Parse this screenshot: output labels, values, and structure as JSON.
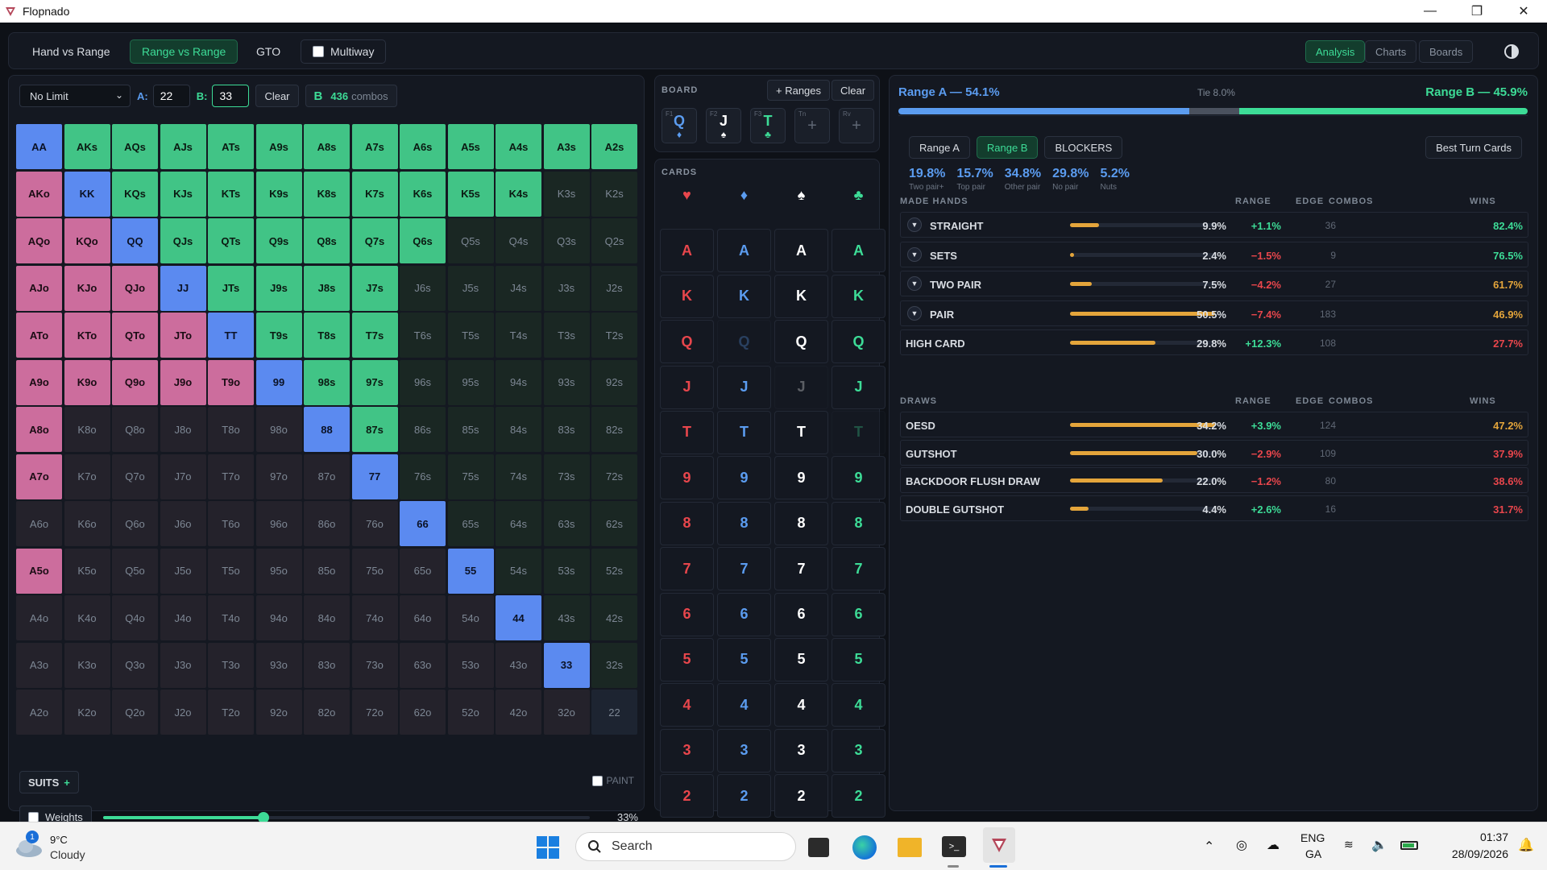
{
  "window": {
    "title": "Flopnado",
    "minimize": "—",
    "maximize": "❐",
    "close": "✕"
  },
  "topbar": {
    "modes": [
      "Hand vs Range",
      "Range vs Range",
      "GTO"
    ],
    "multiway_label": "Multiway",
    "right_tabs": [
      "Analysis",
      "Charts",
      "Boards"
    ]
  },
  "controls": {
    "game": "No Limit",
    "a_label": "A:",
    "a_value": "22",
    "b_label": "B:",
    "b_value": "33",
    "clear": "Clear",
    "b_badge": "B",
    "combos_count": "436",
    "combos_label": "combos"
  },
  "range_grid": {
    "rows": [
      [
        "AA",
        "AKs",
        "AQs",
        "AJs",
        "ATs",
        "A9s",
        "A8s",
        "A7s",
        "A6s",
        "A5s",
        "A4s",
        "A3s",
        "A2s"
      ],
      [
        "AKo",
        "KK",
        "KQs",
        "KJs",
        "KTs",
        "K9s",
        "K8s",
        "K7s",
        "K6s",
        "K5s",
        "K4s",
        "K3s",
        "K2s"
      ],
      [
        "AQo",
        "KQo",
        "QQ",
        "QJs",
        "QTs",
        "Q9s",
        "Q8s",
        "Q7s",
        "Q6s",
        "Q5s",
        "Q4s",
        "Q3s",
        "Q2s"
      ],
      [
        "AJo",
        "KJo",
        "QJo",
        "JJ",
        "JTs",
        "J9s",
        "J8s",
        "J7s",
        "J6s",
        "J5s",
        "J4s",
        "J3s",
        "J2s"
      ],
      [
        "ATo",
        "KTo",
        "QTo",
        "JTo",
        "TT",
        "T9s",
        "T8s",
        "T7s",
        "T6s",
        "T5s",
        "T4s",
        "T3s",
        "T2s"
      ],
      [
        "A9o",
        "K9o",
        "Q9o",
        "J9o",
        "T9o",
        "99",
        "98s",
        "97s",
        "96s",
        "95s",
        "94s",
        "93s",
        "92s"
      ],
      [
        "A8o",
        "K8o",
        "Q8o",
        "J8o",
        "T8o",
        "98o",
        "88",
        "87s",
        "86s",
        "85s",
        "84s",
        "83s",
        "82s"
      ],
      [
        "A7o",
        "K7o",
        "Q7o",
        "J7o",
        "T7o",
        "97o",
        "87o",
        "77",
        "76s",
        "75s",
        "74s",
        "73s",
        "72s"
      ],
      [
        "A6o",
        "K6o",
        "Q6o",
        "J6o",
        "T6o",
        "96o",
        "86o",
        "76o",
        "66",
        "65s",
        "64s",
        "63s",
        "62s"
      ],
      [
        "A5o",
        "K5o",
        "Q5o",
        "J5o",
        "T5o",
        "95o",
        "85o",
        "75o",
        "65o",
        "55",
        "54s",
        "53s",
        "52s"
      ],
      [
        "A4o",
        "K4o",
        "Q4o",
        "J4o",
        "T4o",
        "94o",
        "84o",
        "74o",
        "64o",
        "54o",
        "44",
        "43s",
        "42s"
      ],
      [
        "A3o",
        "K3o",
        "Q3o",
        "J3o",
        "T3o",
        "93o",
        "83o",
        "73o",
        "63o",
        "53o",
        "43o",
        "33",
        "32s"
      ],
      [
        "A2o",
        "K2o",
        "Q2o",
        "J2o",
        "T2o",
        "92o",
        "82o",
        "72o",
        "62o",
        "52o",
        "42o",
        "32o",
        "22"
      ]
    ],
    "states": [
      "PBBBBBBBBBBBB",
      "APBBBBBBBBB..",
      "AAPBBBBBB....",
      "AAAPBBBB.....",
      "AAAAPBBB.....",
      "AAAAAPBB.....",
      "A.....PB.....",
      "A......P.....",
      "........P....",
      "A........P...",
      "..........P..",
      "...........P.",
      "............."
    ]
  },
  "suits_button": "SUITS",
  "suits_plus": "+",
  "paint_label": "PAINT",
  "weights": {
    "label": "Weights",
    "value_text": "33%",
    "value": 0.33
  },
  "board": {
    "label": "BOARD",
    "add_ranges": "+ Ranges",
    "clear": "Clear",
    "cards": [
      {
        "slot": "F1",
        "rank": "Q",
        "suit": "♦",
        "color": "#5b9cf0"
      },
      {
        "slot": "F2",
        "rank": "J",
        "suit": "♠",
        "color": "#ffffff"
      },
      {
        "slot": "F3",
        "rank": "T",
        "suit": "♣",
        "color": "#3ddc97"
      },
      {
        "slot": "Tn",
        "rank": "+",
        "suit": "",
        "color": "#5f6774"
      },
      {
        "slot": "Rv",
        "rank": "+",
        "suit": "",
        "color": "#5f6774"
      }
    ]
  },
  "cards_panel": {
    "label": "CARDS",
    "suits": [
      {
        "symbol": "♥",
        "color": "#e8464c"
      },
      {
        "symbol": "♦",
        "color": "#5b9cf0"
      },
      {
        "symbol": "♠",
        "color": "#ffffff"
      },
      {
        "symbol": "♣",
        "color": "#3ddc97"
      }
    ],
    "ranks": [
      "A",
      "K",
      "Q",
      "J",
      "T",
      "9",
      "8",
      "7",
      "6",
      "5",
      "4",
      "3",
      "2"
    ],
    "used": [
      "Q-1",
      "J-2",
      "T-3"
    ]
  },
  "equity": {
    "a_label": "Range A — 54.1%",
    "tie_label": "Tie 8.0%",
    "b_label": "Range B — 45.9%",
    "a": 0.462,
    "tie": 0.08,
    "b": 0.458
  },
  "analysis_tabs": [
    "Range A",
    "Range B",
    "BLOCKERS"
  ],
  "best_turn": "Best Turn Cards",
  "kpis": [
    {
      "value": "19.8%",
      "label": "Two pair+"
    },
    {
      "value": "15.7%",
      "label": "Top pair"
    },
    {
      "value": "34.8%",
      "label": "Other pair"
    },
    {
      "value": "29.8%",
      "label": "No pair"
    },
    {
      "value": "5.2%",
      "label": "Nuts"
    }
  ],
  "made_hands": {
    "header": "MADE HANDS",
    "cols": [
      "RANGE",
      "EDGE",
      "COMBOS",
      "WINS"
    ],
    "rows": [
      {
        "name": "STRAIGHT",
        "range": "9.9%",
        "edge": "+1.1%",
        "combos": "36",
        "wins": "82.4%",
        "bar": 0.2,
        "edge_color": "#3ddc97",
        "wins_color": "#3ddc97",
        "toggle": true
      },
      {
        "name": "SETS",
        "range": "2.4%",
        "edge": "−1.5%",
        "combos": "9",
        "wins": "76.5%",
        "bar": 0.03,
        "edge_color": "#e8464c",
        "wins_color": "#3ddc97",
        "toggle": true
      },
      {
        "name": "TWO PAIR",
        "range": "7.5%",
        "edge": "−4.2%",
        "combos": "27",
        "wins": "61.7%",
        "bar": 0.15,
        "edge_color": "#e8464c",
        "wins_color": "#e4a53b",
        "toggle": true
      },
      {
        "name": "PAIR",
        "range": "50.5%",
        "edge": "−7.4%",
        "combos": "183",
        "wins": "46.9%",
        "bar": 1.0,
        "edge_color": "#e8464c",
        "wins_color": "#e4a53b",
        "toggle": true
      },
      {
        "name": "HIGH CARD",
        "range": "29.8%",
        "edge": "+12.3%",
        "combos": "108",
        "wins": "27.7%",
        "bar": 0.59,
        "edge_color": "#3ddc97",
        "wins_color": "#e8464c",
        "toggle": false
      }
    ]
  },
  "draws": {
    "header": "DRAWS",
    "cols": [
      "RANGE",
      "EDGE",
      "COMBOS",
      "WINS"
    ],
    "rows": [
      {
        "name": "OESD",
        "range": "34.2%",
        "edge": "+3.9%",
        "combos": "124",
        "wins": "47.2%",
        "bar": 1.0,
        "edge_color": "#3ddc97",
        "wins_color": "#e4a53b"
      },
      {
        "name": "GUTSHOT",
        "range": "30.0%",
        "edge": "−2.9%",
        "combos": "109",
        "wins": "37.9%",
        "bar": 0.88,
        "edge_color": "#e8464c",
        "wins_color": "#e8464c"
      },
      {
        "name": "BACKDOOR FLUSH DRAW",
        "range": "22.0%",
        "edge": "−1.2%",
        "combos": "80",
        "wins": "38.6%",
        "bar": 0.64,
        "edge_color": "#e8464c",
        "wins_color": "#e8464c"
      },
      {
        "name": "DOUBLE GUTSHOT",
        "range": "4.4%",
        "edge": "+2.6%",
        "combos": "16",
        "wins": "31.7%",
        "bar": 0.13,
        "edge_color": "#3ddc97",
        "wins_color": "#e8464c"
      }
    ]
  },
  "taskbar": {
    "weather_temp": "9°C",
    "weather_desc": "Cloudy",
    "weather_badge": "1",
    "search": "Search",
    "lang1": "ENG",
    "lang2": "GA",
    "time": "01:37",
    "date": "28/09/2026"
  }
}
